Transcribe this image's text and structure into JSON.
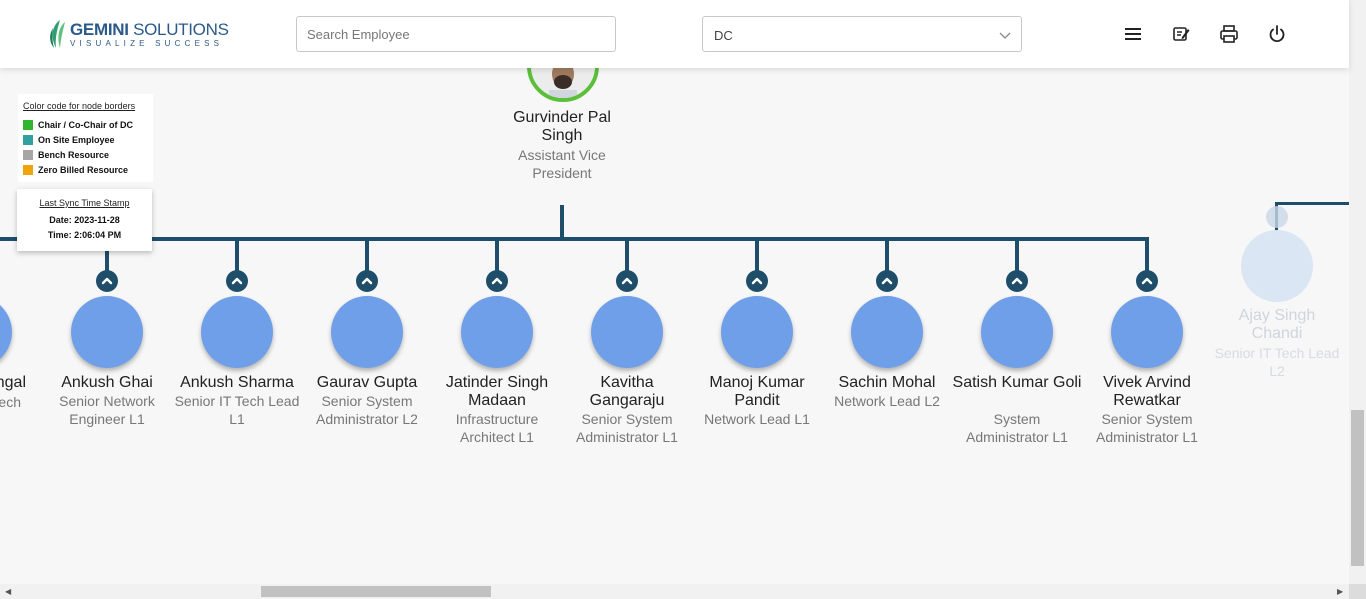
{
  "header": {
    "logo_name_bold": "GEMINI",
    "logo_name_rest": " SOLUTIONS",
    "logo_tagline": "VISUALIZE SUCCESS",
    "search_placeholder": "Search Employee",
    "dropdown_value": "DC",
    "icons": [
      "menu-icon",
      "edit-note-icon",
      "print-icon",
      "power-icon"
    ]
  },
  "legend": {
    "title": "Color code for node borders",
    "items": [
      {
        "label": "Chair / Co-Chair of DC",
        "color": "#2fb52f"
      },
      {
        "label": "On Site Employee",
        "color": "#2fa1a1"
      },
      {
        "label": "Bench Resource",
        "color": "#a6a6a6"
      },
      {
        "label": "Zero Billed Resource",
        "color": "#f0a30a"
      }
    ]
  },
  "sync": {
    "title": "Last Sync Time Stamp",
    "date": "Date: 2023-11-28",
    "time": "Time: 2:06:04 PM"
  },
  "root": {
    "name": "Gurvinder Pal Singh",
    "role": "Assistant Vice President",
    "border_color": "#5cbf3a"
  },
  "partial_left": {
    "name": "ngal",
    "role": "ech"
  },
  "employees": [
    {
      "name": "Ankush Ghai",
      "role": "Senior Network Engineer L1"
    },
    {
      "name": "Ankush Sharma",
      "role": "Senior IT Tech Lead L1"
    },
    {
      "name": "Gaurav Gupta",
      "role": "Senior System Administrator L2"
    },
    {
      "name": "Jatinder Singh Madaan",
      "role": "Infrastructure Architect L1"
    },
    {
      "name": "Kavitha Gangaraju",
      "role": "Senior System Administrator L1"
    },
    {
      "name": "Manoj Kumar Pandit",
      "role": "Network Lead L1"
    },
    {
      "name": "Sachin Mohal",
      "role": "Network Lead L2"
    },
    {
      "name": "Satish Kumar Goli",
      "role": "System Administrator L1"
    },
    {
      "name": "Vivek Arvind Rewatkar",
      "role": "Senior System Administrator L1"
    }
  ],
  "faded_node": {
    "name": "Ajay Singh Chandi",
    "role": "Senior IT Tech Lead L2"
  },
  "colors": {
    "connector": "#1f4e6b",
    "node_fill": "#6f9fe8"
  }
}
